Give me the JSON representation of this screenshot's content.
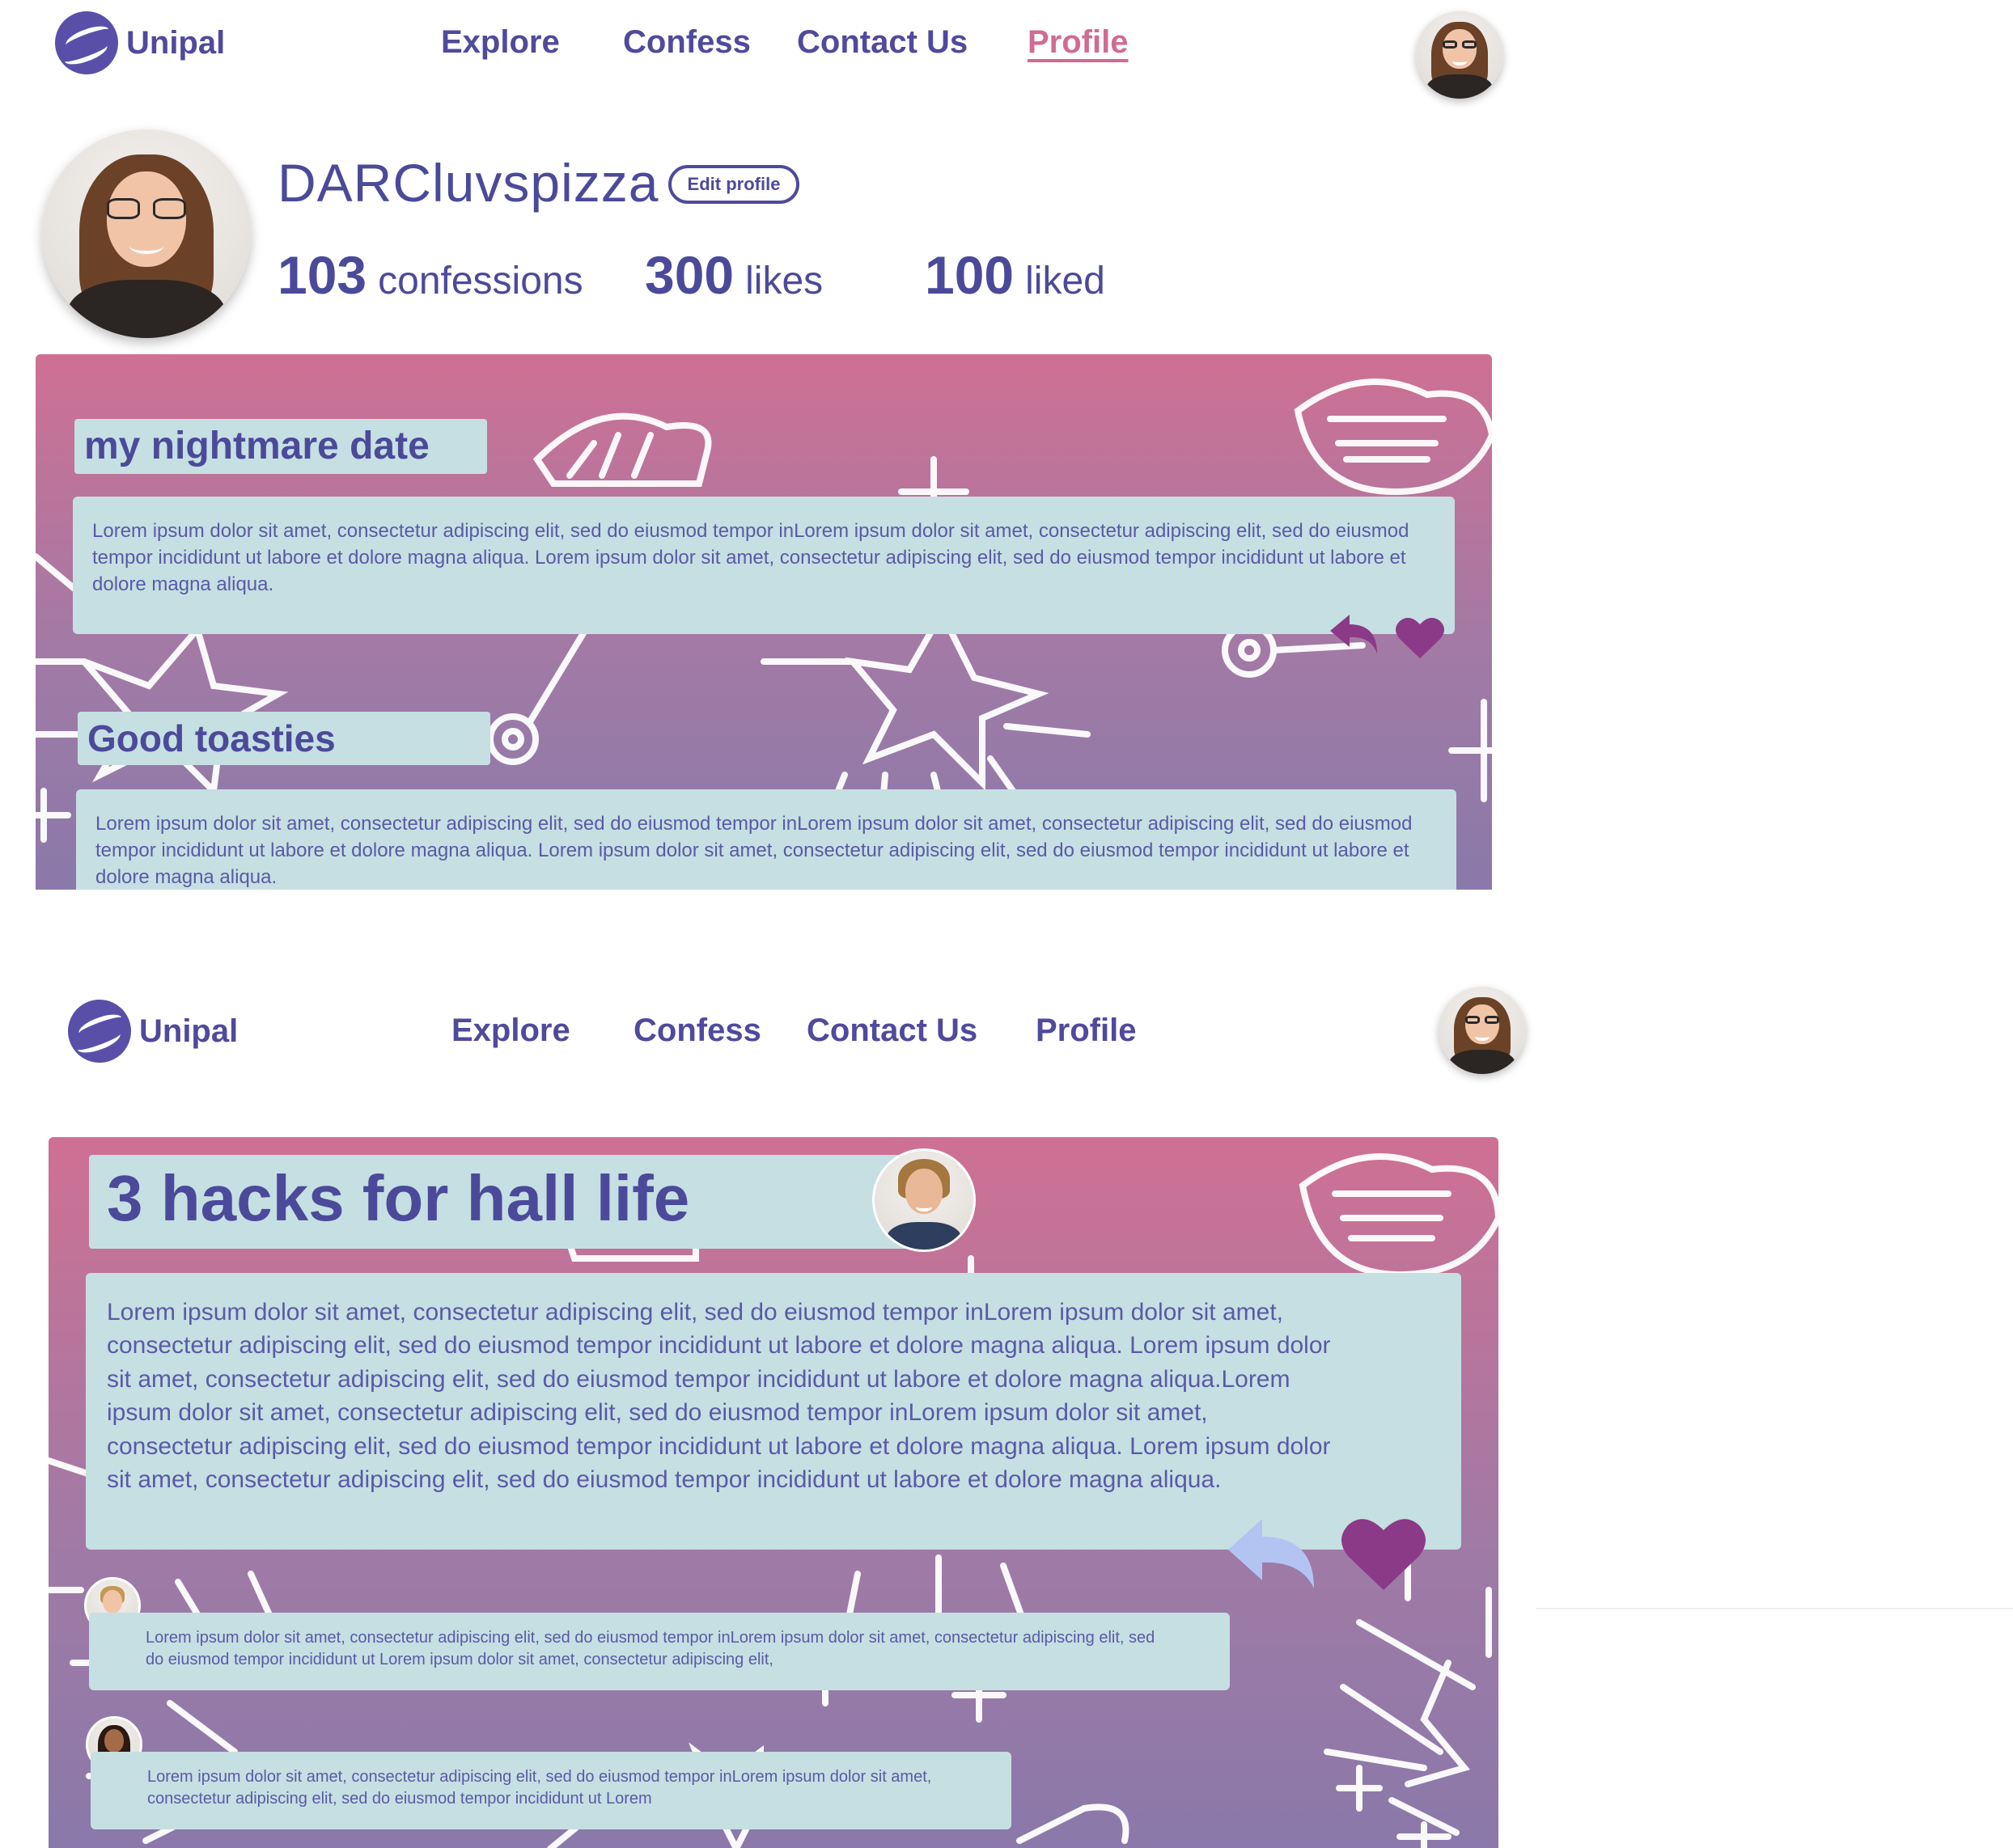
{
  "brand": {
    "name": "Unipal",
    "accent": "#4f4a9c",
    "active": "#d06b93",
    "card_bg": "#c6dfe2"
  },
  "nav": {
    "items": [
      {
        "label": "Explore"
      },
      {
        "label": "Confess"
      },
      {
        "label": "Contact Us"
      },
      {
        "label": "Profile"
      }
    ],
    "active_item_first_screen": "Profile"
  },
  "profile": {
    "username": "DARCluvspizza",
    "edit_label": "Edit profile",
    "stats": [
      {
        "value": "103",
        "label": "confessions"
      },
      {
        "value": "300",
        "label": "likes"
      },
      {
        "value": "100",
        "label": "liked"
      }
    ]
  },
  "feed": {
    "posts": [
      {
        "title": "my nightmare date",
        "body": "Lorem ipsum dolor sit amet, consectetur adipiscing elit, sed do eiusmod tempor inLorem ipsum dolor sit amet, consectetur adipiscing elit, sed do eiusmod tempor incididunt ut labore et dolore magna aliqua. Lorem ipsum dolor sit amet, consectetur adipiscing elit, sed do eiusmod tempor incididunt ut labore et dolore magna aliqua.",
        "icons": [
          "reply-icon",
          "heart-icon"
        ]
      },
      {
        "title": "Good toasties",
        "body": "Lorem ipsum dolor sit amet, consectetur adipiscing elit, sed do eiusmod tempor inLorem ipsum dolor sit amet, consectetur adipiscing elit, sed do eiusmod tempor incididunt ut labore et dolore magna aliqua. Lorem ipsum dolor sit amet, consectetur adipiscing elit, sed do eiusmod tempor incididunt ut labore et dolore magna aliqua."
      }
    ]
  },
  "post_detail": {
    "title": "3 hacks for hall life",
    "body": "Lorem ipsum dolor sit amet, consectetur adipiscing elit, sed do eiusmod tempor inLorem ipsum dolor sit amet, consectetur adipiscing elit, sed do eiusmod tempor incididunt ut labore et dolore magna aliqua. Lorem ipsum dolor sit amet, consectetur adipiscing elit, sed do eiusmod tempor incididunt ut labore et dolore magna aliqua.Lorem ipsum dolor sit amet, consectetur adipiscing elit, sed do eiusmod tempor inLorem ipsum dolor sit amet, consectetur adipiscing elit, sed do eiusmod tempor incididunt ut labore et dolore magna aliqua. Lorem ipsum dolor sit amet, consectetur adipiscing elit, sed do eiusmod tempor incididunt ut labore et dolore magna aliqua.",
    "comments": [
      {
        "text": "Lorem ipsum dolor sit amet, consectetur adipiscing elit, sed do eiusmod tempor inLorem ipsum dolor sit amet, consectetur adipiscing elit, sed do eiusmod tempor incididunt ut Lorem ipsum dolor sit amet, consectetur adipiscing elit,"
      },
      {
        "text": "Lorem ipsum dolor sit amet, consectetur adipiscing elit, sed do eiusmod tempor inLorem ipsum dolor sit amet, consectetur adipiscing elit, sed do eiusmod tempor incididunt ut Lorem"
      }
    ],
    "icons": [
      "reply-icon",
      "heart-icon"
    ]
  }
}
